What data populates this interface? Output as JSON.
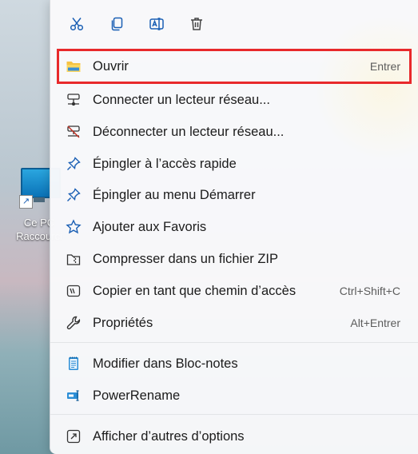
{
  "desktop": {
    "icon_label_line1": "Ce PC",
    "icon_label_line2": "Raccourci"
  },
  "toolbar": {
    "buttons": [
      {
        "icon": "cut-icon"
      },
      {
        "icon": "copy-icon"
      },
      {
        "icon": "rename-icon"
      },
      {
        "icon": "delete-icon"
      }
    ]
  },
  "menu": {
    "items": [
      {
        "label": "Ouvrir",
        "shortcut": "Entrer",
        "icon": "folder-icon",
        "highlighted": true
      },
      {
        "label": "Connecter un lecteur réseau...",
        "shortcut": "",
        "icon": "network-drive-icon"
      },
      {
        "label": "Déconnecter un lecteur réseau...",
        "shortcut": "",
        "icon": "disconnect-drive-icon"
      },
      {
        "label": "Épingler à l’accès rapide",
        "shortcut": "",
        "icon": "pin-icon"
      },
      {
        "label": "Épingler au menu Démarrer",
        "shortcut": "",
        "icon": "pin-icon"
      },
      {
        "label": "Ajouter aux Favoris",
        "shortcut": "",
        "icon": "star-icon"
      },
      {
        "label": "Compresser dans un fichier ZIP",
        "shortcut": "",
        "icon": "zip-icon"
      },
      {
        "label": "Copier en tant que chemin d’accès",
        "shortcut": "Ctrl+Shift+C",
        "icon": "copy-path-icon"
      },
      {
        "label": "Propriétés",
        "shortcut": "Alt+Entrer",
        "icon": "wrench-icon"
      },
      {
        "label": "Modifier dans Bloc-notes",
        "shortcut": "",
        "icon": "notepad-icon"
      },
      {
        "label": "PowerRename",
        "shortcut": "",
        "icon": "powerrename-icon"
      },
      {
        "label": "Afficher d’autres d’options",
        "shortcut": "",
        "icon": "more-options-icon"
      }
    ]
  },
  "colors": {
    "accent": "#1a5fb4",
    "highlight_border": "#e8292b"
  }
}
